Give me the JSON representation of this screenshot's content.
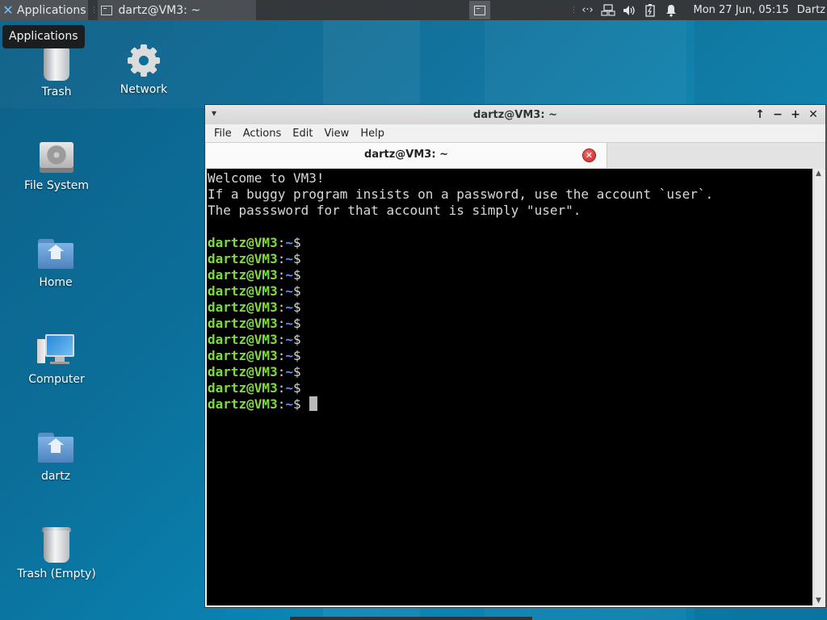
{
  "panel": {
    "applications_label": "Applications",
    "task_title": "dartz@VM3: ~",
    "clock": "Mon 27 Jun, 05:15",
    "user": "Dartz"
  },
  "tooltip": {
    "text": "Applications"
  },
  "desktop_icons": [
    {
      "label": "Trash",
      "icon": "trash-icon"
    },
    {
      "label": "Network",
      "icon": "gear-icon"
    },
    {
      "label": "File System",
      "icon": "hard-drive-icon"
    },
    {
      "label": "Home",
      "icon": "home-folder-icon"
    },
    {
      "label": "Computer",
      "icon": "computer-icon"
    },
    {
      "label": "dartz",
      "icon": "home-folder-icon"
    },
    {
      "label": "Trash (Empty)",
      "icon": "trash-icon"
    }
  ],
  "window": {
    "title": "dartz@VM3: ~",
    "menu": [
      "File",
      "Actions",
      "Edit",
      "View",
      "Help"
    ],
    "tab_label": "dartz@VM3: ~"
  },
  "terminal": {
    "welcome": [
      "Welcome to VM3!",
      "If a buggy program insists on a password, use the account `user`.",
      "The passsword for that account is simply \"user\"."
    ],
    "prompt_user": "dartz@VM3",
    "prompt_colon": ":",
    "prompt_path": "~",
    "prompt_symbol": "$",
    "prompt_count": 11
  },
  "colors": {
    "prompt_user": "#7ddc3a",
    "prompt_path": "#6a8cff",
    "desktop": "#0b7aa8",
    "panel": "#35383b"
  }
}
